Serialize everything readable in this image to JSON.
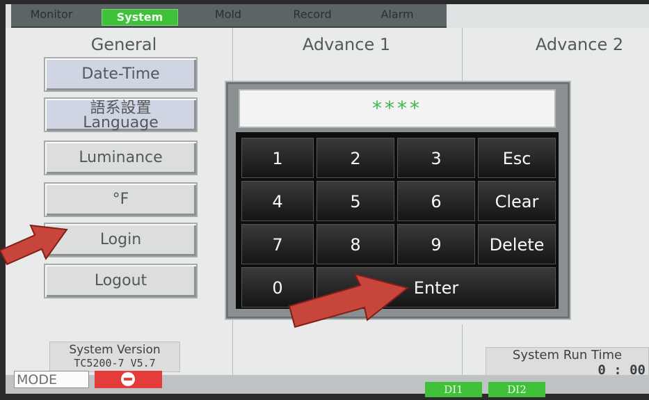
{
  "tabs": [
    "Monitor",
    "System",
    "Mold",
    "Record",
    "Alarm"
  ],
  "columns": {
    "general": "General",
    "advance1": "Advance 1",
    "advance2": "Advance 2"
  },
  "general_buttons": [
    {
      "label": "Date-Time"
    },
    {
      "label_line1": "語系設置",
      "label_line2": "Language"
    },
    {
      "label": "Luminance"
    },
    {
      "label": "°F"
    },
    {
      "label": "Login"
    },
    {
      "label": "Logout"
    }
  ],
  "password_display": "****",
  "keypad": {
    "k1": "1",
    "k2": "2",
    "k3": "3",
    "esc": "Esc",
    "k4": "4",
    "k5": "5",
    "k6": "6",
    "clear": "Clear",
    "k7": "7",
    "k8": "8",
    "k9": "9",
    "delete": "Delete",
    "k0": "0",
    "enter": "Enter"
  },
  "system_version": {
    "label": "System Version",
    "value": "TC5200-7 V5.7"
  },
  "run_time": {
    "label": "System Run Time",
    "value": "0 : 00"
  },
  "status": {
    "mode_label": "MODE",
    "di1": "DI1",
    "di2": "DI2"
  },
  "colors": {
    "active_tab": "#3fc13a",
    "password_digits": "#3fb849",
    "annotation_arrow": "#c8453c",
    "mode_indicator": "#e43b3b"
  }
}
